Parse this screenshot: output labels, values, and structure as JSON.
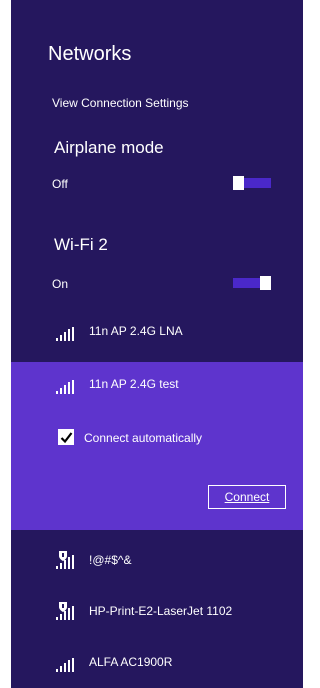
{
  "panel": {
    "title": "Networks",
    "view_settings_link": "View Connection Settings"
  },
  "airplane_mode": {
    "title": "Airplane mode",
    "status": "Off",
    "enabled": false
  },
  "wifi": {
    "title": "Wi-Fi 2",
    "status": "On",
    "enabled": true
  },
  "networks": [
    {
      "name": "11n AP 2.4G LNA",
      "secured": false,
      "signal_icon": "wifi-signal-icon"
    },
    {
      "name": "11n AP 2.4G test",
      "secured": false,
      "selected": true,
      "signal_icon": "wifi-signal-icon",
      "connect_automatically_label": "Connect automatically",
      "connect_automatically_checked": true,
      "connect_button_label": "Connect"
    },
    {
      "name": "!@#$^&",
      "secured": true,
      "signal_icon": "secured-wifi-signal-icon"
    },
    {
      "name": "HP-Print-E2-LaserJet 1102",
      "secured": true,
      "signal_icon": "secured-wifi-signal-icon"
    },
    {
      "name": "ALFA AC1900R",
      "secured": false,
      "signal_icon": "wifi-signal-icon"
    }
  ],
  "colors": {
    "background": "#25175e",
    "selected_background": "#5e34cd",
    "toggle_track": "#4a28c9",
    "foreground": "#ffffff"
  }
}
